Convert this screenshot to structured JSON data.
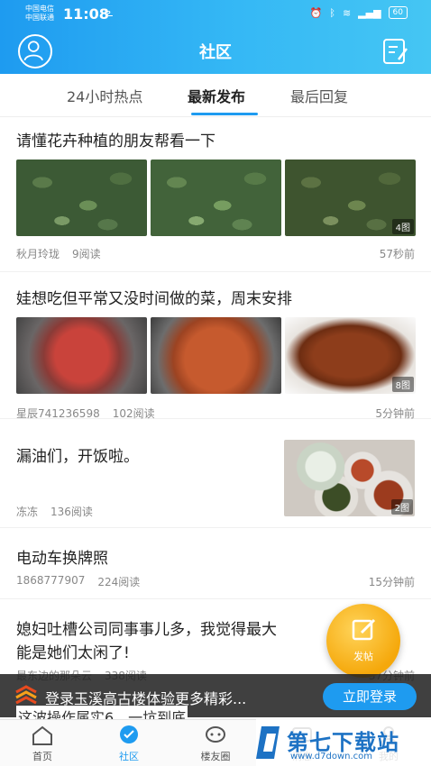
{
  "status_bar": {
    "carrier1": "中国电信",
    "carrier2": "中国联通",
    "time": "11:08",
    "time_extra": "ఽ",
    "battery": "60"
  },
  "header": {
    "title": "社区"
  },
  "tabs": [
    {
      "label": "24小时热点",
      "active": false
    },
    {
      "label": "最新发布",
      "active": true
    },
    {
      "label": "最后回复",
      "active": false
    }
  ],
  "posts": [
    {
      "title": "请懂花卉种植的朋友帮看一下",
      "author": "秋月玲珑",
      "reads": "9阅读",
      "time": "57秒前",
      "image_count": "4图"
    },
    {
      "title": "娃想吃但平常又没时间做的菜，周末安排",
      "author": "星辰741236598",
      "reads": "102阅读",
      "time": "5分钟前",
      "image_count": "8图"
    },
    {
      "title": "漏油们，开饭啦。",
      "author": "冻冻",
      "reads": "136阅读",
      "time": "",
      "image_count": "2图"
    },
    {
      "title": "电动车换牌照",
      "author": "1868777907",
      "reads": "224阅读",
      "time": "15分钟前"
    },
    {
      "title_line1": "媳妇吐槽公司同事事儿多，我觉得最大",
      "title_line2": "能是她们太闲了!",
      "author": "最东边的那朵云",
      "reads": "338阅读",
      "time": "37分钟前"
    }
  ],
  "fab": {
    "label": "发帖"
  },
  "banner": {
    "text": "登录玉溪高古楼体验更多精彩...",
    "button": "立即登录",
    "sub": "这波操作属实6，一坑到底"
  },
  "tabbar": [
    {
      "label": "首页",
      "icon": "home-icon"
    },
    {
      "label": "社区",
      "icon": "community-icon",
      "active": true
    },
    {
      "label": "楼友圈",
      "icon": "chat-icon"
    },
    {
      "label": "消息",
      "icon": "message-icon"
    },
    {
      "label": "我的",
      "icon": "profile-icon"
    }
  ],
  "watermark": {
    "text": "第七下载站",
    "url": "www.d7down.com"
  },
  "colors": {
    "accent": "#1e9bf0",
    "fab": "#f5a80b"
  }
}
